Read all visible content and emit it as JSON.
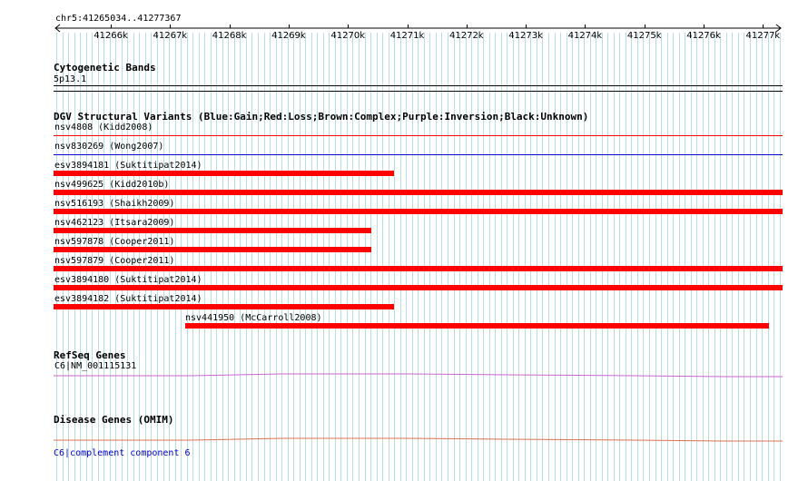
{
  "colors": {
    "grid": "#b8dde2",
    "loss": "#ff0000",
    "gain": "#0000cc",
    "gene": "#cc66cc",
    "disease": "#e07050"
  },
  "ruler": {
    "region": "chr5:41265034..41277367",
    "ticks": [
      "41266k",
      "41267k",
      "41268k",
      "41269k",
      "41270k",
      "41271k",
      "41272k",
      "41273k",
      "41274k",
      "41275k",
      "41276k",
      "41277k"
    ]
  },
  "cytoband": {
    "title": "Cytogenetic Bands",
    "band": "5p13.1"
  },
  "dgv": {
    "title": "DGV Structural Variants (Blue:Gain;Red:Loss;Brown:Complex;Purple:Inversion;Black:Unknown)",
    "variants": [
      {
        "label": "nsv4808 (Kidd2008)",
        "type": "loss-line"
      },
      {
        "label": "nsv830269 (Wong2007)",
        "type": "gain-line"
      },
      {
        "label": "esv3894181 (Suktitipat2014)",
        "type": "loss-bar"
      },
      {
        "label": "nsv499625 (Kidd2010b)",
        "type": "loss-bar"
      },
      {
        "label": "nsv516193 (Shaikh2009)",
        "type": "loss-bar"
      },
      {
        "label": "nsv462123 (Itsara2009)",
        "type": "loss-bar"
      },
      {
        "label": "nsv597878 (Cooper2011)",
        "type": "loss-bar"
      },
      {
        "label": "nsv597879 (Cooper2011)",
        "type": "loss-bar"
      },
      {
        "label": "esv3894180 (Suktitipat2014)",
        "type": "loss-bar"
      },
      {
        "label": "esv3894182 (Suktitipat2014)",
        "type": "loss-bar"
      },
      {
        "label": "nsv441950 (McCarroll2008)",
        "type": "loss-bar"
      }
    ]
  },
  "refseq": {
    "title": "RefSeq Genes",
    "gene": "C6|NM_001115131"
  },
  "omim": {
    "title": "Disease Genes (OMIM)",
    "gene": "C6|complement component 6"
  }
}
